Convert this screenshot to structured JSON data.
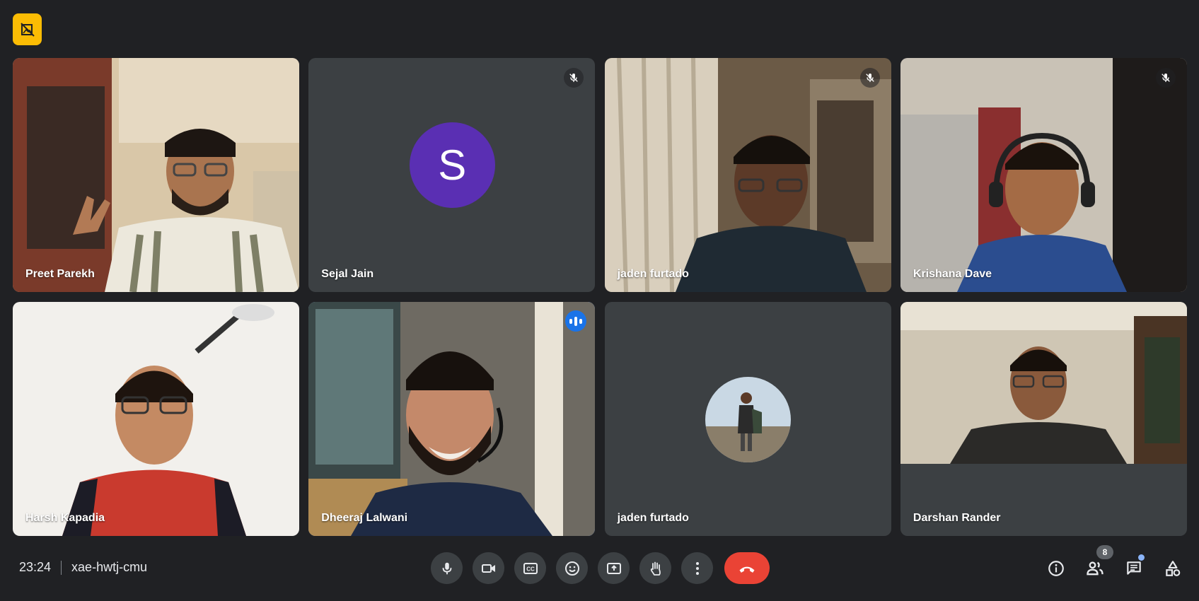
{
  "meeting": {
    "time": "23:24",
    "code": "xae-hwtj-cmu",
    "participant_count": "8"
  },
  "participants": [
    {
      "name": "Preet Parekh",
      "muted": false,
      "mode": "video"
    },
    {
      "name": "Sejal Jain",
      "muted": true,
      "mode": "avatar-letter",
      "initial": "S",
      "avatar_color": "#5a2fb3"
    },
    {
      "name": "jaden furtado",
      "muted": true,
      "mode": "video"
    },
    {
      "name": "Krishana Dave",
      "muted": true,
      "mode": "video"
    },
    {
      "name": "Harsh Kapadia",
      "muted": false,
      "mode": "video"
    },
    {
      "name": "Dheeraj Lalwani",
      "muted": false,
      "mode": "video",
      "speaking": true
    },
    {
      "name": "jaden furtado",
      "muted": false,
      "mode": "avatar-photo"
    },
    {
      "name": "Darshan Rander",
      "muted": false,
      "mode": "video-letterboxed"
    }
  ],
  "controls": [
    "microphone-icon",
    "camera-icon",
    "captions-icon",
    "emoji-icon",
    "present-screen-icon",
    "raise-hand-icon",
    "more-options-icon",
    "end-call-icon"
  ],
  "right_controls": [
    "meeting-details-icon",
    "people-icon",
    "chat-icon",
    "activities-icon"
  ],
  "colors": {
    "background": "#202124",
    "tile": "#3c4043",
    "accent": "#1a73e8",
    "end_call": "#ea4335",
    "badge": "#fbbc04"
  }
}
